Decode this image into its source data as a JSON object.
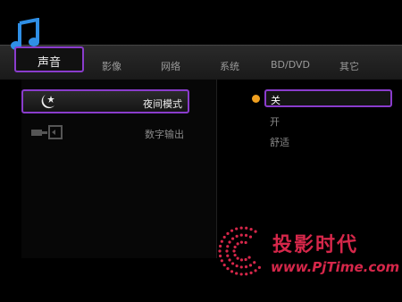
{
  "tabs": [
    "声音",
    "影像",
    "网络",
    "系统",
    "BD/DVD",
    "其它"
  ],
  "menu": [
    {
      "label": "夜间模式",
      "icon": "moon-star-icon"
    },
    {
      "label": "数字输出",
      "icon": "digital-output-icon"
    }
  ],
  "options": [
    "关",
    "开",
    "舒适"
  ],
  "selected_option_marker": "orange-bullet-icon",
  "watermark": {
    "title": "投影时代",
    "url": "www.PjTime.com"
  },
  "colors": {
    "accent": "#8a3ccc",
    "bullet": "#f0a020",
    "watermark": "#d6274a"
  }
}
